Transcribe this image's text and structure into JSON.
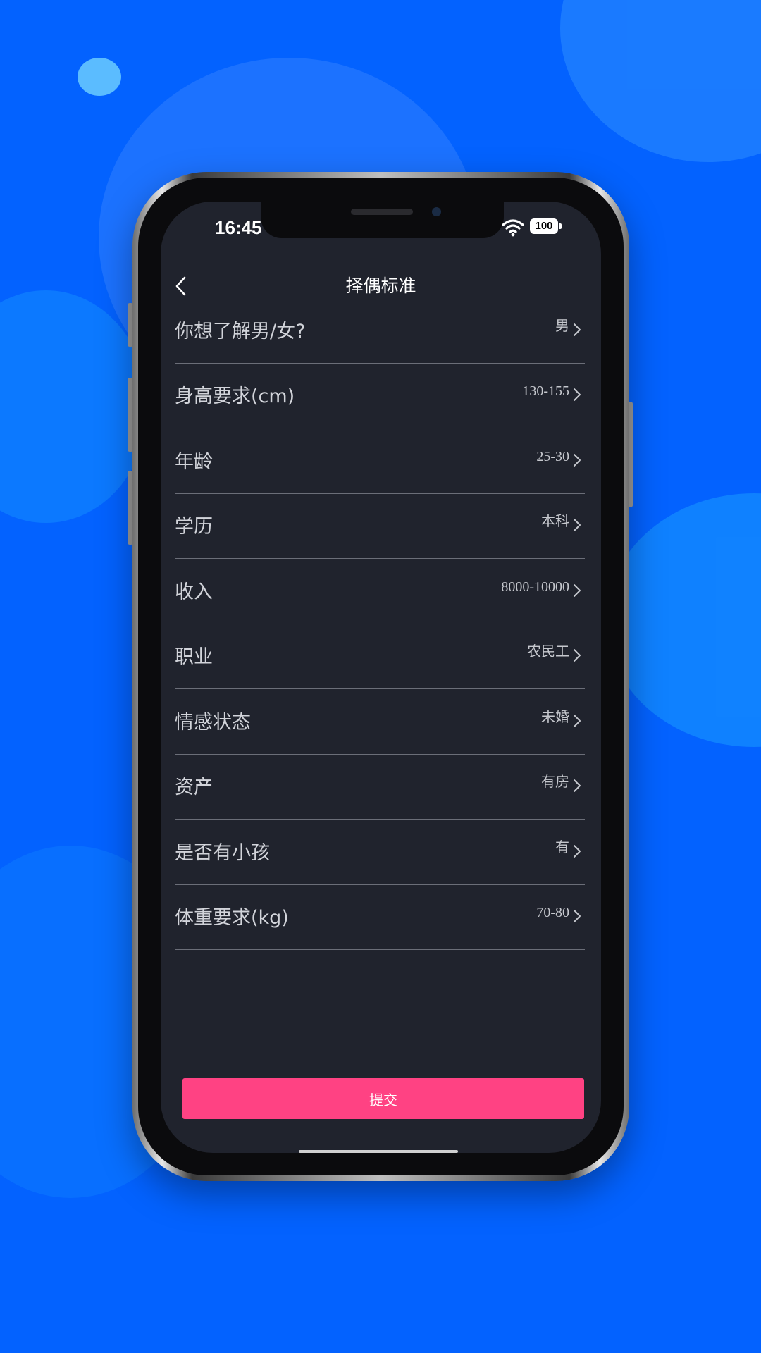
{
  "status_bar": {
    "time": "16:45",
    "battery": "100",
    "wifi_icon": "wifi-icon"
  },
  "header": {
    "title": "择偶标准",
    "back_icon": "chevron-left-icon"
  },
  "criteria": [
    {
      "label": "你想了解男/女?",
      "value": "男"
    },
    {
      "label": "身高要求(cm)",
      "value": "130-155"
    },
    {
      "label": "年龄",
      "value": "25-30"
    },
    {
      "label": "学历",
      "value": "本科"
    },
    {
      "label": "收入",
      "value": "8000-10000"
    },
    {
      "label": "职业",
      "value": "农民工"
    },
    {
      "label": "情感状态",
      "value": "未婚"
    },
    {
      "label": "资产",
      "value": "有房"
    },
    {
      "label": "是否有小孩",
      "value": "有"
    },
    {
      "label": "体重要求(kg)",
      "value": "70-80"
    }
  ],
  "submit_label": "提交",
  "colors": {
    "background": "#0362ff",
    "screen": "#20232d",
    "accent": "#ff4283"
  }
}
